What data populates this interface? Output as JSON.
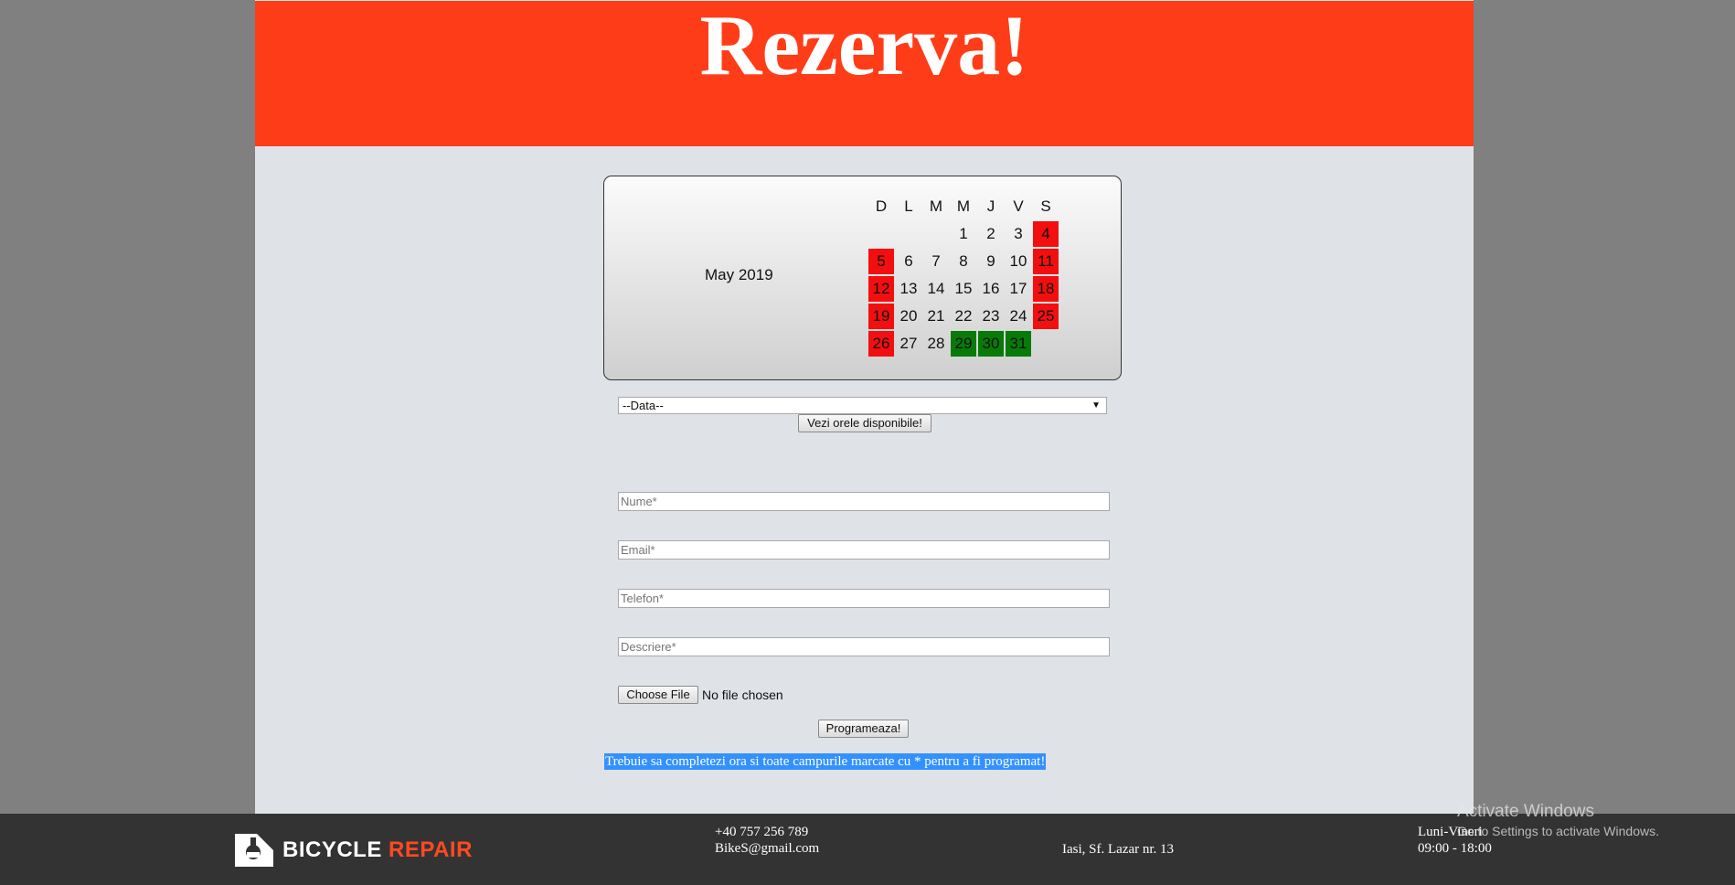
{
  "header": {
    "title": "Rezerva!"
  },
  "calendar": {
    "month_label": "May 2019",
    "weekday_headers": [
      "D",
      "L",
      "M",
      "M",
      "J",
      "V",
      "S"
    ],
    "cells": [
      {
        "day": "",
        "status": "none"
      },
      {
        "day": "",
        "status": "none"
      },
      {
        "day": "",
        "status": "none"
      },
      {
        "day": "1",
        "status": "none"
      },
      {
        "day": "2",
        "status": "none"
      },
      {
        "day": "3",
        "status": "none"
      },
      {
        "day": "4",
        "status": "red"
      },
      {
        "day": "5",
        "status": "red"
      },
      {
        "day": "6",
        "status": "none"
      },
      {
        "day": "7",
        "status": "none"
      },
      {
        "day": "8",
        "status": "none"
      },
      {
        "day": "9",
        "status": "none"
      },
      {
        "day": "10",
        "status": "none"
      },
      {
        "day": "11",
        "status": "red"
      },
      {
        "day": "12",
        "status": "red"
      },
      {
        "day": "13",
        "status": "none"
      },
      {
        "day": "14",
        "status": "none"
      },
      {
        "day": "15",
        "status": "none"
      },
      {
        "day": "16",
        "status": "none"
      },
      {
        "day": "17",
        "status": "none"
      },
      {
        "day": "18",
        "status": "red"
      },
      {
        "day": "19",
        "status": "red"
      },
      {
        "day": "20",
        "status": "none"
      },
      {
        "day": "21",
        "status": "none"
      },
      {
        "day": "22",
        "status": "none"
      },
      {
        "day": "23",
        "status": "none"
      },
      {
        "day": "24",
        "status": "none"
      },
      {
        "day": "25",
        "status": "red"
      },
      {
        "day": "26",
        "status": "red"
      },
      {
        "day": "27",
        "status": "none"
      },
      {
        "day": "28",
        "status": "none"
      },
      {
        "day": "29",
        "status": "green"
      },
      {
        "day": "30",
        "status": "green"
      },
      {
        "day": "31",
        "status": "green"
      }
    ],
    "colors": {
      "red": "#f30f0f",
      "green": "#087a08"
    }
  },
  "form": {
    "date_select": {
      "selected": "--Data--"
    },
    "hours_button": "Vezi orele disponibile!",
    "name_placeholder": "Nume*",
    "email_placeholder": "Email*",
    "phone_placeholder": "Telefon*",
    "description_placeholder": "Descriere*",
    "file_button": "Choose File",
    "file_status": "No file chosen",
    "submit_button": "Programeaza!",
    "notice": "Trebuie sa completezi ora si toate campurile marcate cu * pentru a fi programat!"
  },
  "footer": {
    "logo_word1": "BICYCLE",
    "logo_word2": "REPAIR",
    "phone": "+40 757 256 789",
    "email": "BikeS@gmail.com",
    "address": "Iasi, Sf. Lazar nr. 13",
    "hours_days": "Luni-Vineri",
    "hours_time": "09:00 - 18:00",
    "accent_color": "#ff4a21"
  },
  "watermark": {
    "title": "Activate Windows",
    "subtitle": "Go to Settings to activate Windows."
  }
}
